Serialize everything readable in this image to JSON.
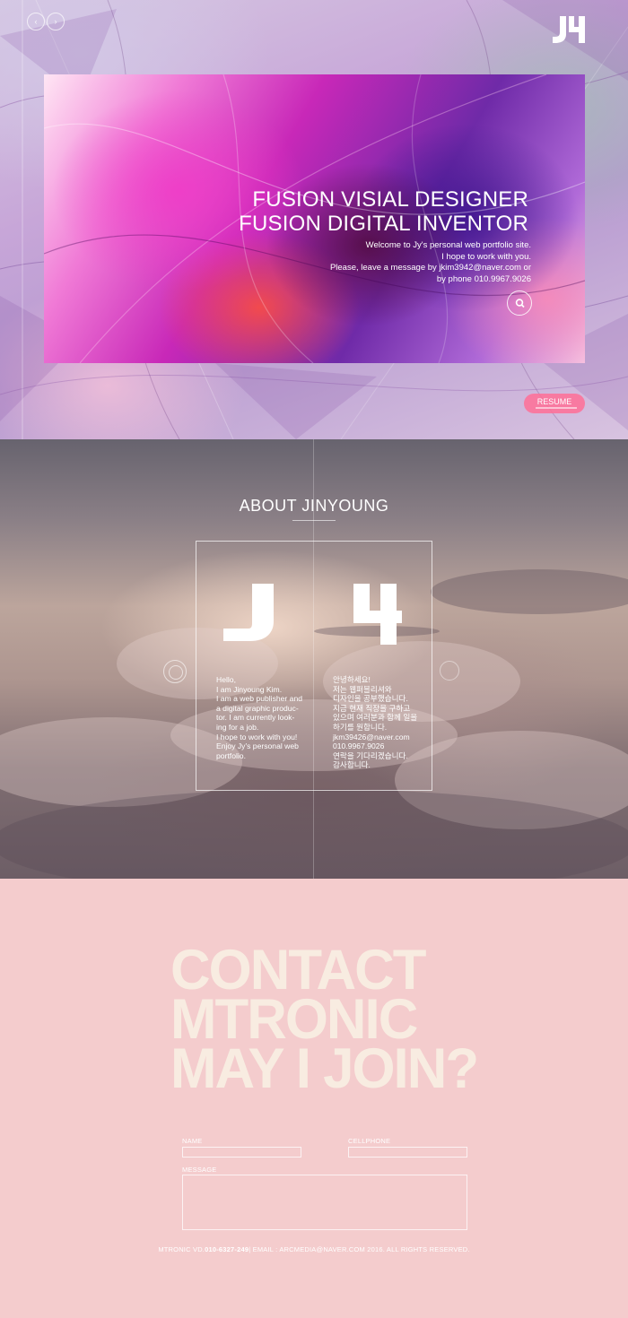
{
  "hero": {
    "nav_prev": "‹",
    "nav_next": "›",
    "logo": "JY",
    "title_line1": "FUSION  VISIAL DESIGNER",
    "title_line2": "FUSION DIGITAL INVENTOR",
    "intro_lines": [
      "Welcome to Jy's personal web portfolio site.",
      "I hope to work with you.",
      "Please, leave a message by jkim3942@naver.com or",
      "by phone  010.9967.9026"
    ],
    "search_icon": "search-icon",
    "resume_label": "RESUME"
  },
  "about": {
    "title": "ABOUT JINYOUNG",
    "english_lines": [
      "Hello,",
      "I am Jinyoung Kim.",
      "I am a web publisher and",
      "a digital graphic produc-",
      "tor. I am  currently look-",
      "ing for a job.",
      "I hope to work with you!",
      "Enjoy Jy's personal web",
      "portfolio."
    ],
    "korean_lines": [
      "안녕하세요!",
      "저는 웹퍼블리셔와",
      "디자인을 공부했습니다.",
      "지금 현재 직장을 구하고",
      "있으며 여러분과 함께 일을",
      "하기를 원합니다.",
      "jkm39426@naver.com",
      "010.9967.9026",
      "연락을 기다리겠습니다.",
      "감사합니다."
    ]
  },
  "contact": {
    "headline_line1": "CONTACT",
    "headline_line2": "MTRONIC",
    "headline_line3": "MAY I JOIN?",
    "name_label": "NAME",
    "cellphone_label": "CELLPHONE",
    "message_label": "MESSAGE",
    "footer_prefix": "MTRONIC VD.",
    "footer_phone": "010-6327-249",
    "footer_suffix": "| EMAIL : ARCMEDIA@NAVER.COM 2016. ALL RIGHTS RESERVED."
  },
  "colors": {
    "contact_bg": "#f4cccd",
    "headline": "#f8ece1",
    "resume_button": "#ff6e96"
  }
}
